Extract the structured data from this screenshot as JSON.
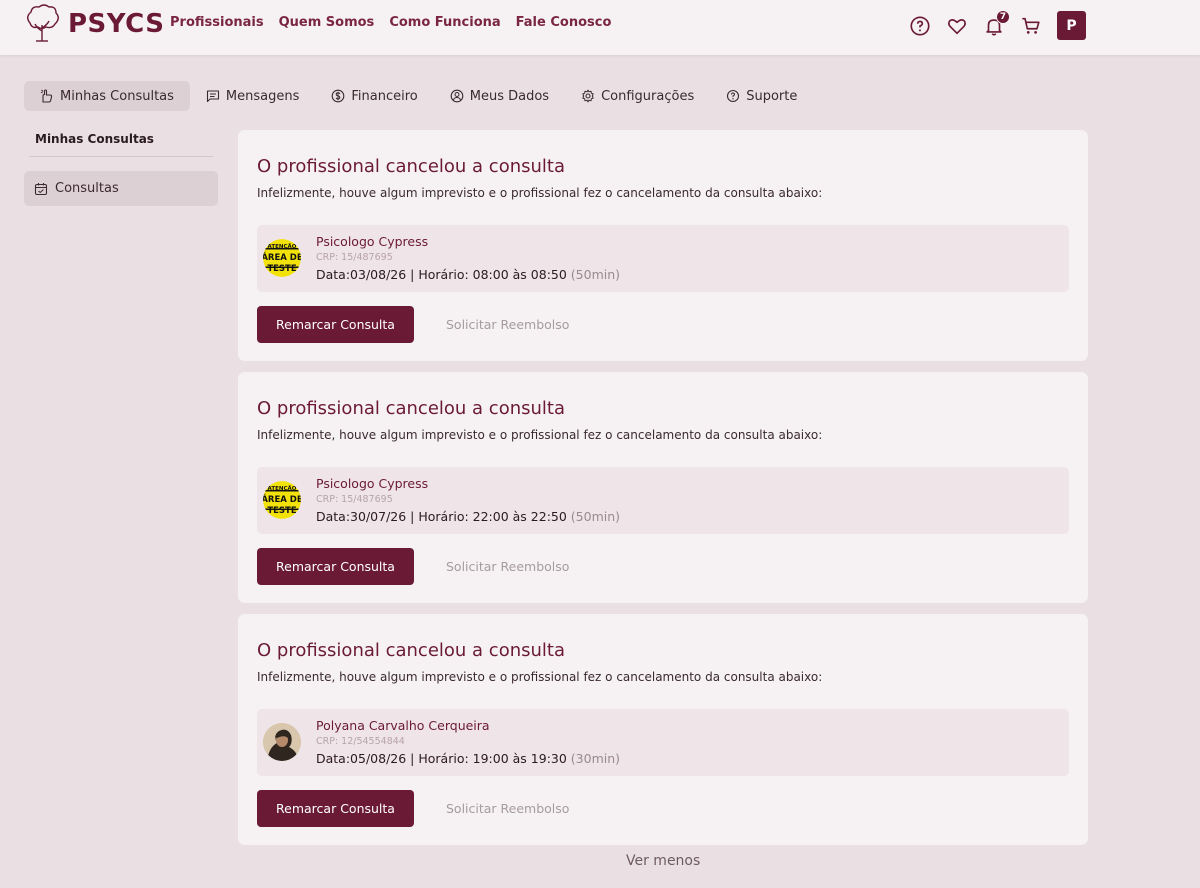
{
  "header": {
    "brand": "PSYCS",
    "nav": [
      "Profissionais",
      "Quem Somos",
      "Como Funciona",
      "Fale Conosco"
    ],
    "notification_count": "7",
    "avatar_initial": "P",
    "icons": [
      "help-icon",
      "heart-icon",
      "bell-icon",
      "cart-icon"
    ]
  },
  "tabs": [
    {
      "label": "Minhas Consultas",
      "icon": "hand-icon",
      "active": true
    },
    {
      "label": "Mensagens",
      "icon": "chat-icon"
    },
    {
      "label": "Financeiro",
      "icon": "dollar-icon"
    },
    {
      "label": "Meus Dados",
      "icon": "user-icon"
    },
    {
      "label": "Configurações",
      "icon": "gear-icon"
    },
    {
      "label": "Suporte",
      "icon": "help-icon"
    }
  ],
  "sidebar": {
    "title": "Minhas Consultas",
    "items": [
      {
        "label": "Consultas",
        "icon": "calendar-icon"
      }
    ]
  },
  "cards": [
    {
      "title": "O profissional cancelou a consulta",
      "subtitle": "Infelizmente, houve algum imprevisto e o profissional fez o cancelamento da consulta abaixo:",
      "professional": "Psicologo Cypress",
      "crp": "CRP: 15/487695",
      "datetime": "Data:03/08/26 | Horário: 08:00 às 08:50",
      "duration": "(50min)",
      "avatar": "warning-sign",
      "avatar_text": [
        "ATENÇÃO",
        "ÁREA DE",
        "TESTE"
      ],
      "primary_button": "Remarcar Consulta",
      "link": "Solicitar Reembolso"
    },
    {
      "title": "O profissional cancelou a consulta",
      "subtitle": "Infelizmente, houve algum imprevisto e o profissional fez o cancelamento da consulta abaixo:",
      "professional": "Psicologo Cypress",
      "crp": "CRP: 15/487695",
      "datetime": "Data:30/07/26 | Horário: 22:00 às 22:50",
      "duration": "(50min)",
      "avatar": "warning-sign",
      "avatar_text": [
        "ATENÇÃO",
        "ÁREA DE",
        "TESTE"
      ],
      "primary_button": "Remarcar Consulta",
      "link": "Solicitar Reembolso"
    },
    {
      "title": "O profissional cancelou a consulta",
      "subtitle": "Infelizmente, houve algum imprevisto e o profissional fez o cancelamento da consulta abaixo:",
      "professional": "Polyana Carvalho Cerqueira",
      "crp": "CRP: 12/54554844",
      "datetime": "Data:05/08/26 | Horário: 19:00 às 19:30",
      "duration": "(30min)",
      "avatar": "photo",
      "primary_button": "Remarcar Consulta",
      "link": "Solicitar Reembolso"
    }
  ],
  "footer_link": "Ver menos",
  "colors": {
    "brand": "#6b1a35",
    "background": "#eae0e3",
    "card": "#f6f2f3",
    "appointment_bg": "#efe4e8"
  }
}
